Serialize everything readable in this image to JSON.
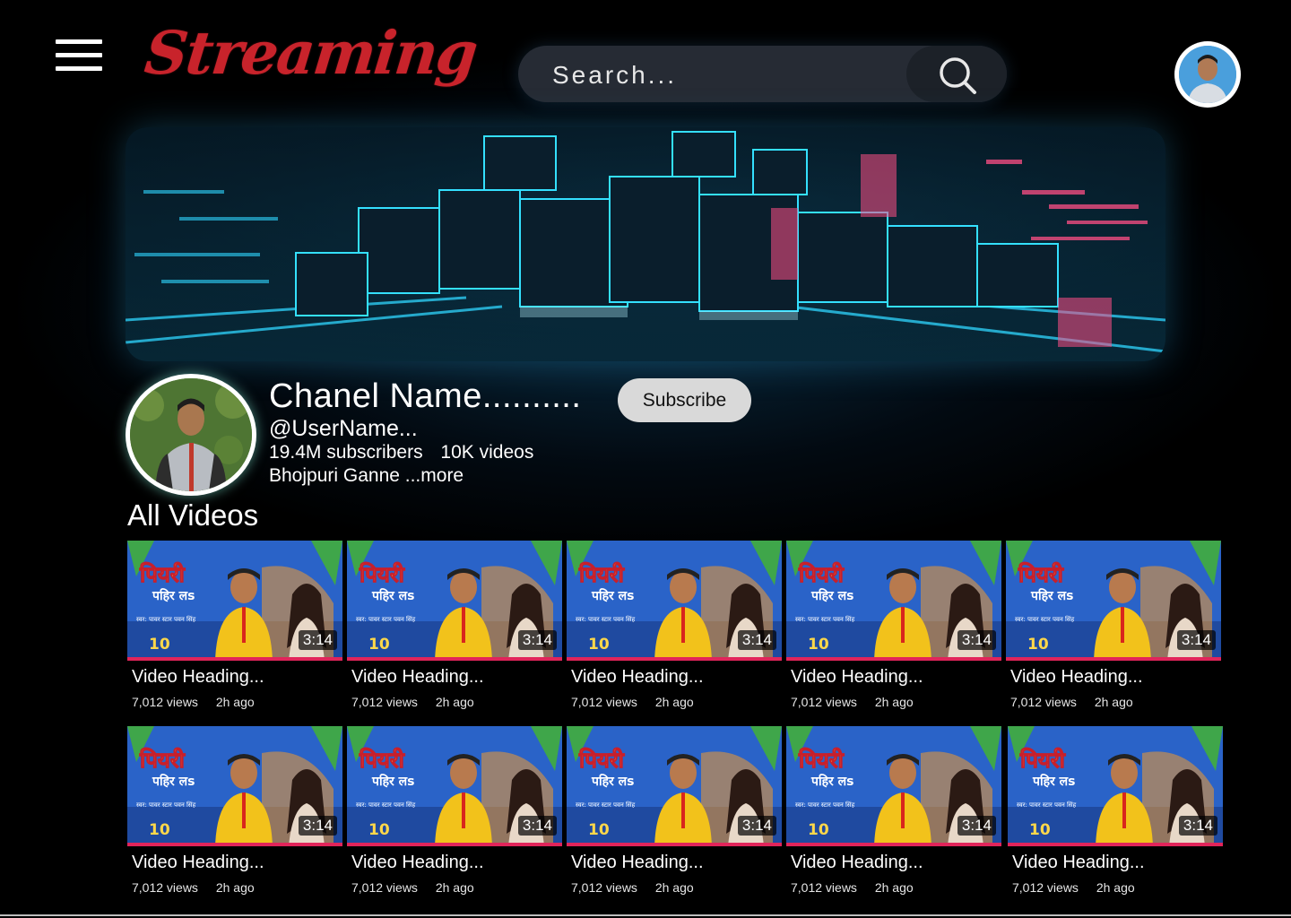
{
  "header": {
    "logo": "Streaming",
    "search_placeholder": "Search..."
  },
  "channel": {
    "name": "Chanel Name..........",
    "handle": "@UserName...",
    "subscribers": "19.4M subscribers",
    "videos": "10K videos",
    "description": "Bhojpuri Ganne ...more",
    "subscribe_label": "Subscribe"
  },
  "section_title": "All Videos",
  "thumbnail_overlay": {
    "title_line1": "पियरी",
    "title_line2": "पहिर लs",
    "credit": "स्वर: पावर स्टार पवन सिंह",
    "views_badge": "10"
  },
  "videos": [
    {
      "title": "Video Heading...",
      "views": "7,012 views",
      "age": "2h ago",
      "duration": "3:14"
    },
    {
      "title": "Video Heading...",
      "views": "7,012 views",
      "age": "2h ago",
      "duration": "3:14"
    },
    {
      "title": "Video Heading...",
      "views": "7,012 views",
      "age": "2h ago",
      "duration": "3:14"
    },
    {
      "title": "Video Heading...",
      "views": "7,012 views",
      "age": "2h ago",
      "duration": "3:14"
    },
    {
      "title": "Video Heading...",
      "views": "7,012 views",
      "age": "2h ago",
      "duration": "3:14"
    },
    {
      "title": "Video Heading...",
      "views": "7,012 views",
      "age": "2h ago",
      "duration": "3:14"
    },
    {
      "title": "Video Heading...",
      "views": "7,012 views",
      "age": "2h ago",
      "duration": "3:14"
    },
    {
      "title": "Video Heading...",
      "views": "7,012 views",
      "age": "2h ago",
      "duration": "3:14"
    },
    {
      "title": "Video Heading...",
      "views": "7,012 views",
      "age": "2h ago",
      "duration": "3:14"
    },
    {
      "title": "Video Heading...",
      "views": "7,012 views",
      "age": "2h ago",
      "duration": "3:14"
    }
  ],
  "colors": {
    "background": "#000000",
    "logo": "#c8232b",
    "search_bg": "#262b34",
    "subscribe_bg": "#d9d9d9",
    "banner_glow": "#2fd6ff",
    "banner_accent": "#ff3f7a"
  },
  "icons": {
    "menu": "hamburger-menu-icon",
    "search": "search-icon",
    "profile": "avatar"
  }
}
